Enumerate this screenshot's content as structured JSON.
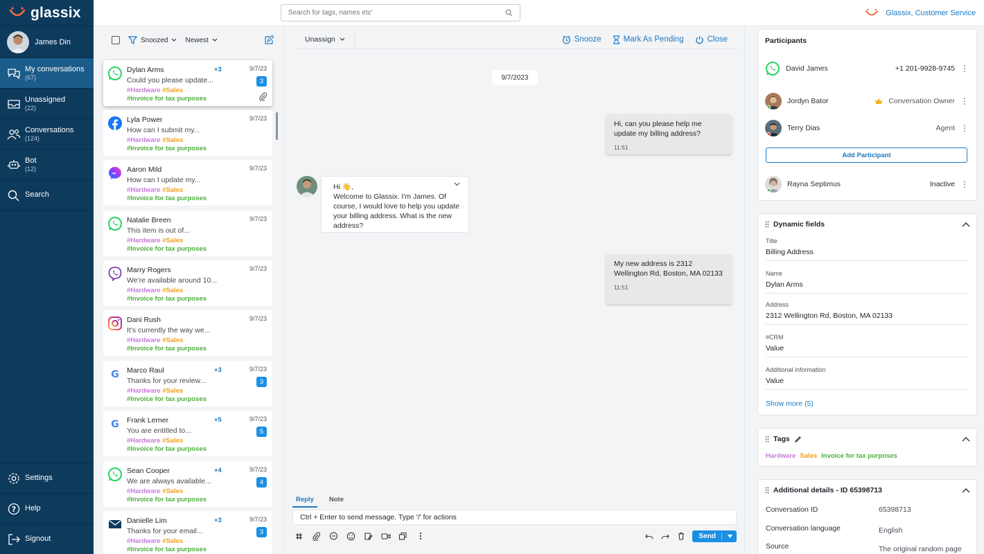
{
  "brand": {
    "name": "glassix",
    "accent": "#f26c3d"
  },
  "user": {
    "name": "James Din"
  },
  "nav": {
    "items": [
      {
        "label": "My conversations",
        "count": "(67)",
        "icon": "chat-bubbles-icon"
      },
      {
        "label": "Unassigned",
        "count": "(22)",
        "icon": "inbox-icon"
      },
      {
        "label": "Conversations",
        "count": "(124)",
        "icon": "users-icon"
      },
      {
        "label": "Bot",
        "count": "(12)",
        "icon": "bot-icon"
      },
      {
        "label": "Search",
        "count": "",
        "icon": "search-icon"
      }
    ],
    "bottom": [
      {
        "label": "Settings",
        "icon": "gear-icon"
      },
      {
        "label": "Help",
        "icon": "help-icon"
      },
      {
        "label": "Signout",
        "icon": "signout-icon"
      }
    ]
  },
  "topbar": {
    "search_placeholder": "Search for tags, names etc'",
    "org_name": "Glassix, Customer Service"
  },
  "list": {
    "filter": "Snoozed",
    "sort": "Newest",
    "tags": {
      "hw": "#Hardware",
      "sales": "#Sales",
      "inv": "#Invoice for tax purposes"
    },
    "conversations": [
      {
        "name": "Dylan Arms",
        "plus": "+3",
        "date": "9/7/23",
        "preview": "Could you please update...",
        "badge": "3",
        "channel": "whatsapp",
        "attachment": true
      },
      {
        "name": "Lyla Power",
        "plus": "",
        "date": "9/7/23",
        "preview": "How can I submit my...",
        "badge": "",
        "channel": "facebook"
      },
      {
        "name": "Aaron Mild",
        "plus": "",
        "date": "9/7/23",
        "preview": "How can I update my...",
        "badge": "",
        "channel": "messenger"
      },
      {
        "name": "Natalie Breen",
        "plus": "",
        "date": "9/7/23",
        "preview": "This item is out of...",
        "badge": "",
        "channel": "whatsapp"
      },
      {
        "name": "Marry Rogers",
        "plus": "",
        "date": "9/7/23",
        "preview": "We're available around 10...",
        "badge": "",
        "channel": "viber"
      },
      {
        "name": "Dani Rush",
        "plus": "",
        "date": "9/7/23",
        "preview": "It's currently the way we...",
        "badge": "",
        "channel": "instagram"
      },
      {
        "name": "Marco Raul",
        "plus": "+3",
        "date": "9/7/23",
        "preview": "Thanks for your review...",
        "badge": "3",
        "channel": "google"
      },
      {
        "name": "Frank Lerner",
        "plus": "+5",
        "date": "9/7/23",
        "preview": "You are entitled to...",
        "badge": "5",
        "channel": "google"
      },
      {
        "name": "Sean Cooper",
        "plus": "+4",
        "date": "9/7/23",
        "preview": "We are always available...",
        "badge": "4",
        "channel": "whatsapp"
      },
      {
        "name": "Danielle Lim",
        "plus": "+3",
        "date": "9/7/23",
        "preview": "Thanks for your email...",
        "badge": "3",
        "channel": "email"
      }
    ]
  },
  "chat": {
    "unassign": "Unassign",
    "snooze": "Snooze",
    "pending": "Mark As Pending",
    "close": "Close",
    "date": "9/7/2023",
    "msg1": {
      "text": "Hi, can you please help me update my billing address?",
      "time": "11:51"
    },
    "msg2": {
      "greeting": "Hi 👋,",
      "text": "Welcome to Glassix. I'm James. Of course, I would love to help you update your billing address. What is the new address?"
    },
    "msg3": {
      "text": "My new address is 2312 Wellington Rd, Boston, MA 02133",
      "time": "11:51"
    },
    "tab_reply": "Reply",
    "tab_note": "Note",
    "input_value": "Ctrl + Enter to send message. Type '/' for actions",
    "send": "Send"
  },
  "participants": {
    "title": "Participants",
    "customer": {
      "name": "David James",
      "phone": "+1 201-9928-9745"
    },
    "owner": {
      "name": "Jordyn Bator",
      "role": "Conversation Owner"
    },
    "agent": {
      "name": "Terry Dias",
      "role": "Agent"
    },
    "add": "Add Participant",
    "inactive": {
      "name": "Rayna Septimus",
      "role": "Inactive"
    }
  },
  "dynamic": {
    "title": "Dynamic fields",
    "fields": [
      {
        "label": "Title",
        "value": "Billing Address"
      },
      {
        "label": "Name",
        "value": "Dylan Arms"
      },
      {
        "label": "Address",
        "value": "2312 Wellington Rd, Boston, MA 02133"
      },
      {
        "label": "#CRM",
        "value": "Value"
      },
      {
        "label": "Additional information",
        "value": "Value"
      }
    ],
    "show_more": "Show more (5)"
  },
  "tags_panel": {
    "title": "Tags",
    "hw": "Hardware",
    "sales": "Sales",
    "inv": "Invoice for tax purposes"
  },
  "details": {
    "title": "Additional details -  ID 65398713",
    "rows": [
      {
        "label": "Conversation ID",
        "value": "65398713"
      },
      {
        "label": "Conversation language",
        "value": "English"
      },
      {
        "label": "Source",
        "value": "The original random page"
      }
    ]
  }
}
